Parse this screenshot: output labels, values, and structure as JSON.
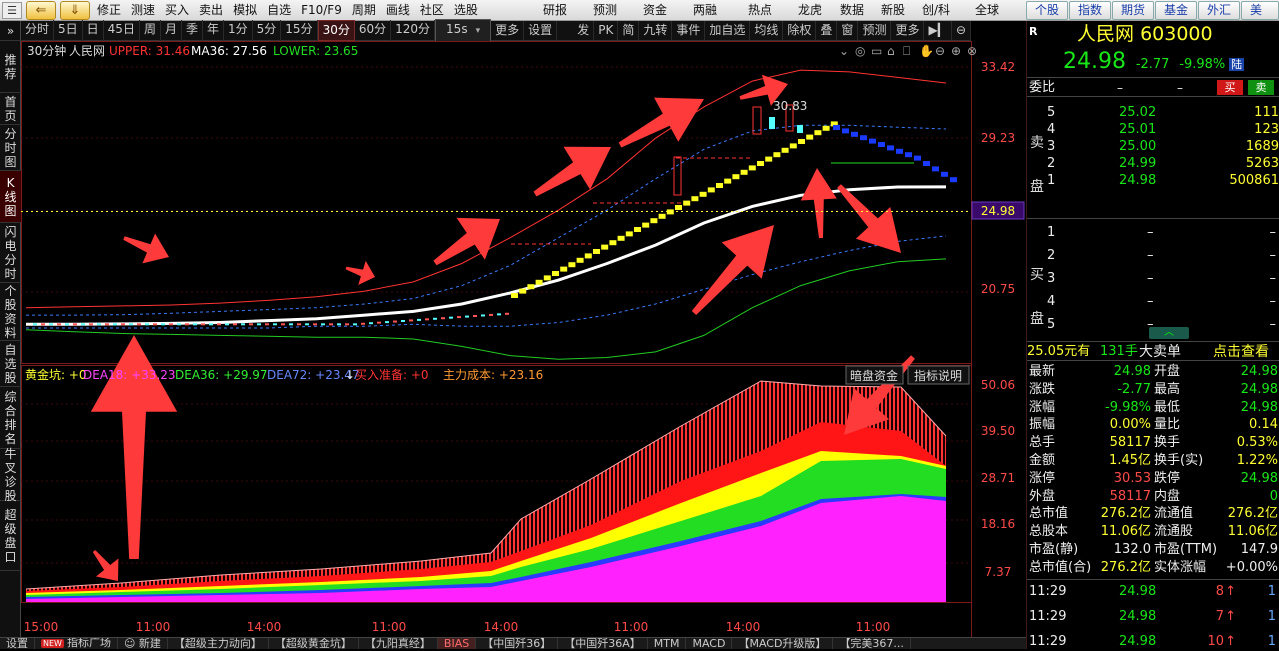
{
  "toolbar": {
    "items": [
      "修正",
      "测速",
      "买入",
      "卖出",
      "模拟",
      "自选",
      "F10/F9",
      "周期",
      "画线",
      "社区",
      "选股"
    ],
    "right_buttons": [
      "研报",
      "预测",
      "资金",
      "两融",
      "热点",
      "龙虎",
      "数据",
      "新股",
      "创/科",
      "全球"
    ],
    "far_right": [
      "个股",
      "指数",
      "期货",
      "基金",
      "外汇",
      "美股"
    ]
  },
  "periodbar": {
    "periods": [
      "分时",
      "5日",
      "日",
      "45日",
      "周",
      "月",
      "季",
      "年",
      "1分",
      "5分",
      "15分",
      "30分",
      "60分",
      "120分"
    ],
    "active_period": "30分",
    "select_value": "15s",
    "extra": [
      "更多",
      "设置"
    ],
    "right_tools": [
      "发",
      "PK",
      "简",
      "九转",
      "事件",
      "加自选",
      "均线",
      "除权",
      "叠",
      "窗",
      "预测",
      "更多"
    ]
  },
  "left_tabs": [
    "推荐",
    "首页",
    "分时图",
    "K线图",
    "闪电分时",
    "个股资料",
    "自选股",
    "综合排名",
    "牛叉诊股",
    "超级盘口"
  ],
  "main_chart": {
    "period_label": "30分钟",
    "stock_name": "人民网",
    "upper": "UPPER: 31.46",
    "ma36": "MA36: 27.56",
    "lower": "LOWER: 23.65",
    "price_axis": [
      "33.42",
      "29.23",
      "24.98",
      "20.75"
    ],
    "current_price_tag": "24.98",
    "high_label": "30.83"
  },
  "sub_chart": {
    "legend": [
      {
        "text": "黄金坑: +0",
        "color": "#ffff33"
      },
      {
        "text": "DEA18: +33.23",
        "color": "#ff44ff"
      },
      {
        "text": "DEA36: +29.97",
        "color": "#33ee33"
      },
      {
        "text": "DEA72: +23.47",
        "color": "#6688ff"
      },
      {
        "text": "买入准备: +0",
        "color": "#ff3333"
      },
      {
        "text": "主力成本: +23.16",
        "color": "#ff9933"
      }
    ],
    "btn_dark": "暗盘资金",
    "btn_help": "指标说明",
    "axis": [
      "50.06",
      "39.50",
      "28.71",
      "18.16",
      "7.37"
    ]
  },
  "time_axis": [
    "15:00",
    "11:00",
    "14:00",
    "11:00",
    "14:00",
    "11:00",
    "14:00",
    "11:00"
  ],
  "quote": {
    "name": "人民网",
    "code": "603000",
    "price": "24.98",
    "change": "-2.77",
    "pct": "-9.98%",
    "badge": "陆",
    "r_badge": "R",
    "weibi_label": "委比",
    "weibi_value": "–",
    "weibi_value2": "–",
    "buy_btn": "买",
    "sell_btn": "卖",
    "sell_side_label": "卖盘",
    "buy_side_label": "买盘",
    "sells": [
      {
        "lvl": "5",
        "price": "25.02",
        "vol": "111"
      },
      {
        "lvl": "4",
        "price": "25.01",
        "vol": "123"
      },
      {
        "lvl": "3",
        "price": "25.00",
        "vol": "1689"
      },
      {
        "lvl": "2",
        "price": "24.99",
        "vol": "5263"
      },
      {
        "lvl": "1",
        "price": "24.98",
        "vol": "500861"
      }
    ],
    "buys": [
      {
        "lvl": "1",
        "price": "–",
        "vol": "–"
      },
      {
        "lvl": "2",
        "price": "–",
        "vol": "–"
      },
      {
        "lvl": "3",
        "price": "–",
        "vol": "–"
      },
      {
        "lvl": "4",
        "price": "–",
        "vol": "–"
      },
      {
        "lvl": "5",
        "price": "–",
        "vol": "–"
      }
    ],
    "big_order": {
      "price": "25.05元有",
      "hands": "131手",
      "type": "大卖单",
      "link": "点击查看"
    },
    "stats": [
      {
        "k1": "最新",
        "v1": "24.98",
        "c1": "green",
        "k2": "开盘",
        "v2": "24.98",
        "c2": "green"
      },
      {
        "k1": "涨跌",
        "v1": "-2.77",
        "c1": "green",
        "k2": "最高",
        "v2": "24.98",
        "c2": "green"
      },
      {
        "k1": "涨幅",
        "v1": "-9.98%",
        "c1": "green",
        "k2": "最低",
        "v2": "24.98",
        "c2": "green"
      },
      {
        "k1": "振幅",
        "v1": "0.00%",
        "c1": "yel",
        "k2": "量比",
        "v2": "0.14",
        "c2": "yel"
      },
      {
        "k1": "总手",
        "v1": "58117",
        "c1": "yel",
        "k2": "换手",
        "v2": "0.53%",
        "c2": "yel"
      },
      {
        "k1": "金额",
        "v1": "1.45亿",
        "c1": "yel",
        "k2": "换手(实)",
        "v2": "1.22%",
        "c2": "yel"
      },
      {
        "k1": "涨停",
        "v1": "30.53",
        "c1": "red",
        "k2": "跌停",
        "v2": "24.98",
        "c2": "green"
      },
      {
        "k1": "外盘",
        "v1": "58117",
        "c1": "red",
        "k2": "内盘",
        "v2": "0",
        "c2": "green"
      },
      {
        "k1": "总市值",
        "v1": "276.2亿",
        "c1": "yel",
        "k2": "流通值",
        "v2": "276.2亿",
        "c2": "yel"
      },
      {
        "k1": "总股本",
        "v1": "11.06亿",
        "c1": "yel",
        "k2": "流通股",
        "v2": "11.06亿",
        "c2": "yel"
      },
      {
        "k1": "市盈(静)",
        "v1": "132.0",
        "c1": "wht",
        "k2": "市盈(TTM)",
        "v2": "147.9",
        "c2": "wht"
      },
      {
        "k1": "总市值(合)",
        "v1": "276.2亿",
        "c1": "yel",
        "k2": "实体涨幅",
        "v2": "+0.00%",
        "c2": "wht"
      }
    ],
    "ticks": [
      {
        "time": "11:29",
        "price": "24.98",
        "vol": "8",
        "dir": "↑",
        "n": "1"
      },
      {
        "time": "11:29",
        "price": "24.98",
        "vol": "7",
        "dir": "↑",
        "n": "1"
      },
      {
        "time": "11:29",
        "price": "24.98",
        "vol": "10",
        "dir": "↑",
        "n": "1"
      }
    ]
  },
  "bottom_tabs": [
    "设置",
    "指标广场",
    "新建",
    "【超级主力动向】",
    "【超级黄金坑】",
    "【九阳真经】",
    "BIAS",
    "【中国歼36】",
    "【中国歼36A】",
    "MTM",
    "MACD",
    "【MACD升级版】",
    "【完美367..."
  ],
  "bottom_active": "BIAS",
  "bottom_new_badge": "NEW",
  "colors": {
    "up": "#ff3333",
    "down": "#19e619",
    "bg": "#000000",
    "boll_upper": "#ff3333",
    "boll_mid": "#ffffff",
    "boll_lower": "#22cc22",
    "arrow": "#ff3030"
  },
  "chart_data": {
    "type": "line",
    "title": "",
    "series": [
      {
        "name": "UPPER",
        "values": [
          21.0,
          21.05,
          21.1,
          21.15,
          21.25,
          21.4,
          21.6,
          21.9,
          22.4,
          23.4,
          24.8,
          26.3,
          28.0,
          30.2,
          31.9,
          33.3,
          33.9,
          33.8,
          33.5,
          33.2
        ]
      },
      {
        "name": "MA36",
        "values": [
          20.1,
          20.1,
          20.12,
          20.15,
          20.2,
          20.3,
          20.4,
          20.6,
          20.8,
          21.2,
          21.8,
          22.5,
          23.4,
          24.4,
          25.6,
          26.5,
          27.1,
          27.4,
          27.55,
          27.56
        ]
      },
      {
        "name": "LOWER",
        "values": [
          19.8,
          19.7,
          19.6,
          19.55,
          19.5,
          19.45,
          19.4,
          19.4,
          19.3,
          18.9,
          18.4,
          18.2,
          18.3,
          18.6,
          19.5,
          21.0,
          22.2,
          23.0,
          23.5,
          23.65
        ]
      }
    ],
    "ylim": [
      18.0,
      34.5
    ]
  }
}
